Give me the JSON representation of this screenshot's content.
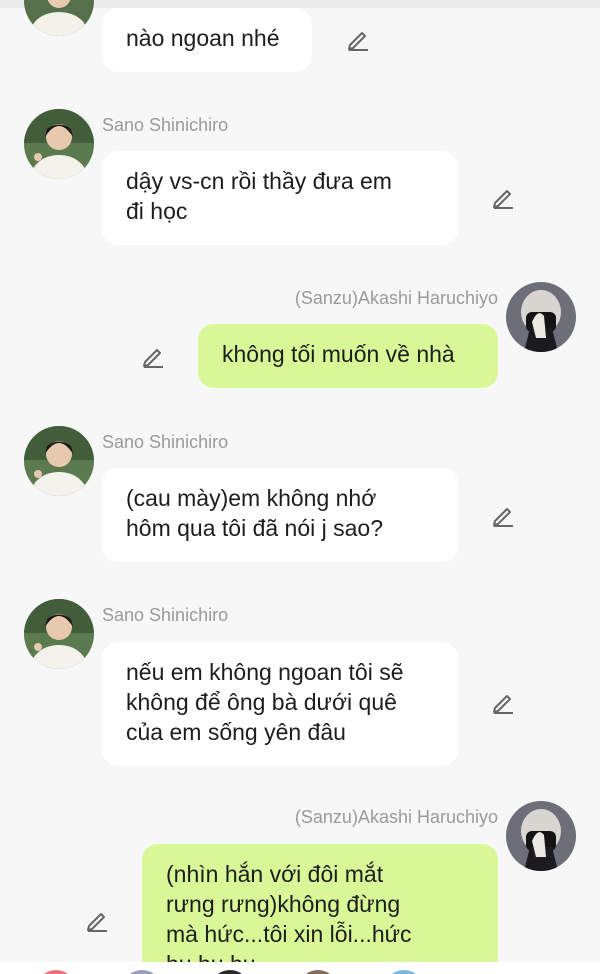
{
  "messages": [
    {
      "sender": "",
      "text": "nào ngoan nhé",
      "side": "in"
    },
    {
      "sender": "Sano Shinichiro",
      "text": "dậy vs-cn rồi thầy đưa em\nđi học",
      "side": "in"
    },
    {
      "sender": "(Sanzu)Akashi Haruchiyo",
      "text": "không tối muốn về nhà",
      "side": "out"
    },
    {
      "sender": "Sano Shinichiro",
      "text": "(cau mày)em không nhớ\nhôm qua tôi đã nói j sao?",
      "side": "in"
    },
    {
      "sender": "Sano Shinichiro",
      "text": "nếu em không ngoan tôi sẽ\nkhông để ông bà dưới quê\ncủa em sống yên đâu",
      "side": "in"
    },
    {
      "sender": "(Sanzu)Akashi Haruchiyo",
      "text": "(nhìn hắn với đôi mắt\nrưng rưng)không đừng\nmà hức...tôi xin lỗi...hức\nhu hu hu",
      "side": "out"
    }
  ],
  "icons": {
    "edit": "pencil-edit-icon",
    "avatar_shinichiro": "shinichiro-avatar",
    "avatar_haruchiyo": "haruchiyo-avatar"
  },
  "colors": {
    "background": "#f7f7f7",
    "incoming_bubble": "#ffffff",
    "outgoing_bubble": "#d8f796",
    "name_text": "#9a9a9a",
    "message_text": "#1d1d1d"
  }
}
